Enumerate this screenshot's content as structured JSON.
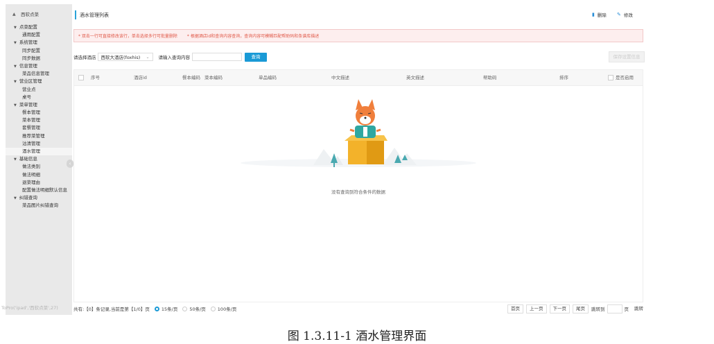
{
  "sidebar": {
    "top": "西软点菜",
    "items": [
      {
        "label": "点菜配置",
        "group": true
      },
      {
        "label": "通用配置"
      },
      {
        "label": "系统管理",
        "group": true
      },
      {
        "label": "同步配置"
      },
      {
        "label": "同步数据"
      },
      {
        "label": "信息管理",
        "group": true
      },
      {
        "label": "菜品信息管理"
      },
      {
        "label": "营业区管理",
        "group": true
      },
      {
        "label": "营业点"
      },
      {
        "label": "桌号"
      },
      {
        "label": "菜单管理",
        "group": true
      },
      {
        "label": "餐本管理"
      },
      {
        "label": "菜本管理"
      },
      {
        "label": "套餐管理"
      },
      {
        "label": "推荐菜管理"
      },
      {
        "label": "沽清管理"
      },
      {
        "label": "酒水管理",
        "active": true
      },
      {
        "label": "基础信息",
        "group": true
      },
      {
        "label": "做法类别"
      },
      {
        "label": "做法明细"
      },
      {
        "label": "退菜理由"
      },
      {
        "label": "配置做法明细默认信息"
      },
      {
        "label": "纠错查询",
        "group": true
      },
      {
        "label": "菜品图片纠错查询"
      }
    ],
    "footer": "ToPro('ipad','西软点菜',27)"
  },
  "header": {
    "title": "酒水管理列表",
    "delete_label": "删除",
    "edit_label": "修改"
  },
  "hint": {
    "tip1": "* 双击一行可直接修改该行，单击选择多行可批量删除",
    "tip2": "* 根据酒店id和查询内容查询，查询内容可模糊匹配帮助码和条谱库描述"
  },
  "toolbar": {
    "hotel_label": "请选择酒店",
    "hotel_value": "西软大酒店(foxhis)",
    "query_label": "请输入查询内容",
    "query_button": "查询",
    "save_button": "保存设置信息"
  },
  "table": {
    "columns": [
      "序号",
      "酒店id",
      "餐本编码",
      "菜本编码",
      "单品编码",
      "中文描述",
      "英文描述",
      "帮助码",
      "排序",
      "是否启用"
    ],
    "empty_text": "没有查询到符合条件的数据"
  },
  "pager": {
    "summary": "共有:【0】条记录,当前是第【1/0】页",
    "size_options": [
      "15条/页",
      "50条/页",
      "100条/页"
    ],
    "selected_size": "15条/页",
    "first": "首页",
    "prev": "上一页",
    "next": "下一页",
    "last": "尾页",
    "jump_label": "跳转到",
    "page_unit": "页",
    "jump_button": "跳转"
  },
  "caption": "图 1.3.11-1  酒水管理界面",
  "colors": {
    "accent": "#1a9ad6",
    "hint_bg": "#fdeeee",
    "hint_text": "#e05a4a",
    "sidebar_bg": "#e9e9e9"
  },
  "icons": {
    "sidebar_top": "home-icon",
    "delete": "trash-icon",
    "edit": "pencil-icon",
    "empty": "fox-in-box-illustration"
  }
}
